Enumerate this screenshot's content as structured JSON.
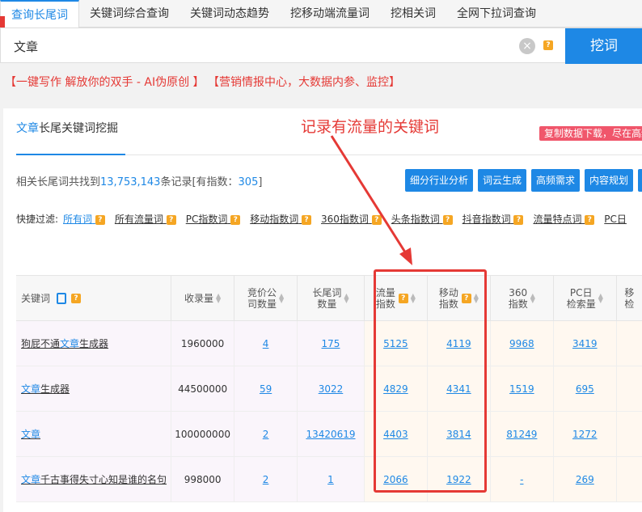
{
  "top_tabs": [
    "查询长尾词",
    "关键词综合查询",
    "关键词动态趋势",
    "挖移动端流量词",
    "挖相关词",
    "全网下拉词查询"
  ],
  "search": {
    "value": "文章",
    "button": "挖词",
    "help": "?"
  },
  "promo": {
    "left": "【一键写作 解放你的双手 - AI伪原创 】",
    "right": "【营销情报中心，大数据内参、监控】"
  },
  "panel": {
    "tab_highlight": "文章",
    "tab_rest": "长尾关键词挖掘",
    "annotation": "记录有流量的关键词",
    "copy_banner": "复制数据下载，尽在高级版"
  },
  "summary": {
    "prefix": "相关长尾词共找到",
    "total": "13,753,143",
    "mid": "条记录[有指数：",
    "indexed": "305",
    "suffix": "]"
  },
  "action_buttons": [
    "细分行业分析",
    "词云生成",
    "高频需求",
    "内容规划",
    "需"
  ],
  "filters": {
    "label": "快捷过滤:",
    "items": [
      "所有词",
      "所有流量词",
      "PC指数词",
      "移动指数词",
      "360指数词",
      "头条指数词",
      "抖音指数词",
      "流量特点词",
      "PC日"
    ]
  },
  "table": {
    "headers": [
      "关键词",
      "收录量",
      "竞价公司数量",
      "长尾词数量",
      "流量指数",
      "移动指数",
      "360指数",
      "PC日检索量",
      "移检"
    ],
    "header_lines": [
      [
        "关键词"
      ],
      [
        "收录量"
      ],
      [
        "竞价公",
        "司数量"
      ],
      [
        "长尾词",
        "数量"
      ],
      [
        "流量",
        "指数"
      ],
      [
        "移动",
        "指数"
      ],
      [
        "360",
        "指数"
      ],
      [
        "PC日",
        "检索量"
      ],
      [
        "移",
        "检"
      ]
    ],
    "rows": [
      {
        "kw_pre": "狗屁不通",
        "kw_hl": "文章",
        "kw_post": "生成器",
        "collect": "1960000",
        "bid": "4",
        "longtail": "175",
        "flow": "5125",
        "mobile": "4119",
        "i360": "9968",
        "pc": "3419"
      },
      {
        "kw_pre": "",
        "kw_hl": "文章",
        "kw_post": "生成器",
        "collect": "44500000",
        "bid": "59",
        "longtail": "3022",
        "flow": "4829",
        "mobile": "4341",
        "i360": "1519",
        "pc": "695"
      },
      {
        "kw_pre": "",
        "kw_hl": "文章",
        "kw_post": "",
        "collect": "100000000",
        "bid": "2",
        "longtail": "13420619",
        "flow": "4403",
        "mobile": "3814",
        "i360": "81249",
        "pc": "1272"
      },
      {
        "kw_pre": "",
        "kw_hl": "文章",
        "kw_post": "千古事得失寸心知是谁的名句",
        "collect": "998000",
        "bid": "2",
        "longtail": "1",
        "flow": "2066",
        "mobile": "1922",
        "i360": "-",
        "pc": "269"
      }
    ]
  },
  "colors": {
    "accent": "#1e88e5",
    "red": "#e53935",
    "help": "#f5a623"
  }
}
